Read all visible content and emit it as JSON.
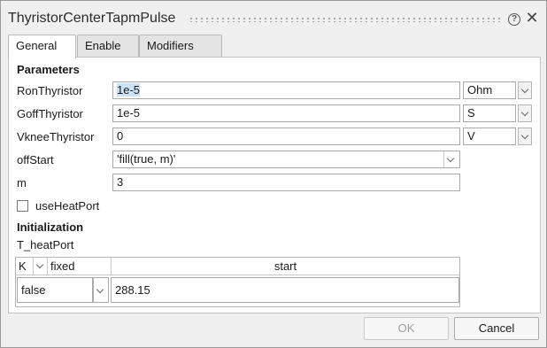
{
  "window": {
    "title": "ThyristorCenterTapmPulse"
  },
  "tabs": [
    {
      "label": "General"
    },
    {
      "label": "Enable"
    },
    {
      "label": "Modifiers"
    }
  ],
  "parameters": {
    "heading": "Parameters",
    "RonThyristor": {
      "label": "RonThyristor",
      "value": "1e-5",
      "unit": "Ohm"
    },
    "GoffThyristor": {
      "label": "GoffThyristor",
      "value": "1e-5",
      "unit": "S"
    },
    "VkneeThyristor": {
      "label": "VkneeThyristor",
      "value": "0",
      "unit": "V"
    },
    "offStart": {
      "label": "offStart",
      "value": "'fill(true, m)'"
    },
    "m": {
      "label": "m",
      "value": "3"
    },
    "useHeatPort": {
      "label": "useHeatPort",
      "checked": false
    }
  },
  "initialization": {
    "heading": "Initialization",
    "T_heatPort": {
      "label": "T_heatPort",
      "unit": "K",
      "col_fixed": "fixed",
      "col_start": "start",
      "fixed_value": "false",
      "start_value": "288.15"
    }
  },
  "buttons": {
    "ok": "OK",
    "cancel": "Cancel"
  },
  "colors": {
    "selection": "#cce3f7",
    "panel": "#ffffff",
    "chrome": "#f0f0f0"
  }
}
